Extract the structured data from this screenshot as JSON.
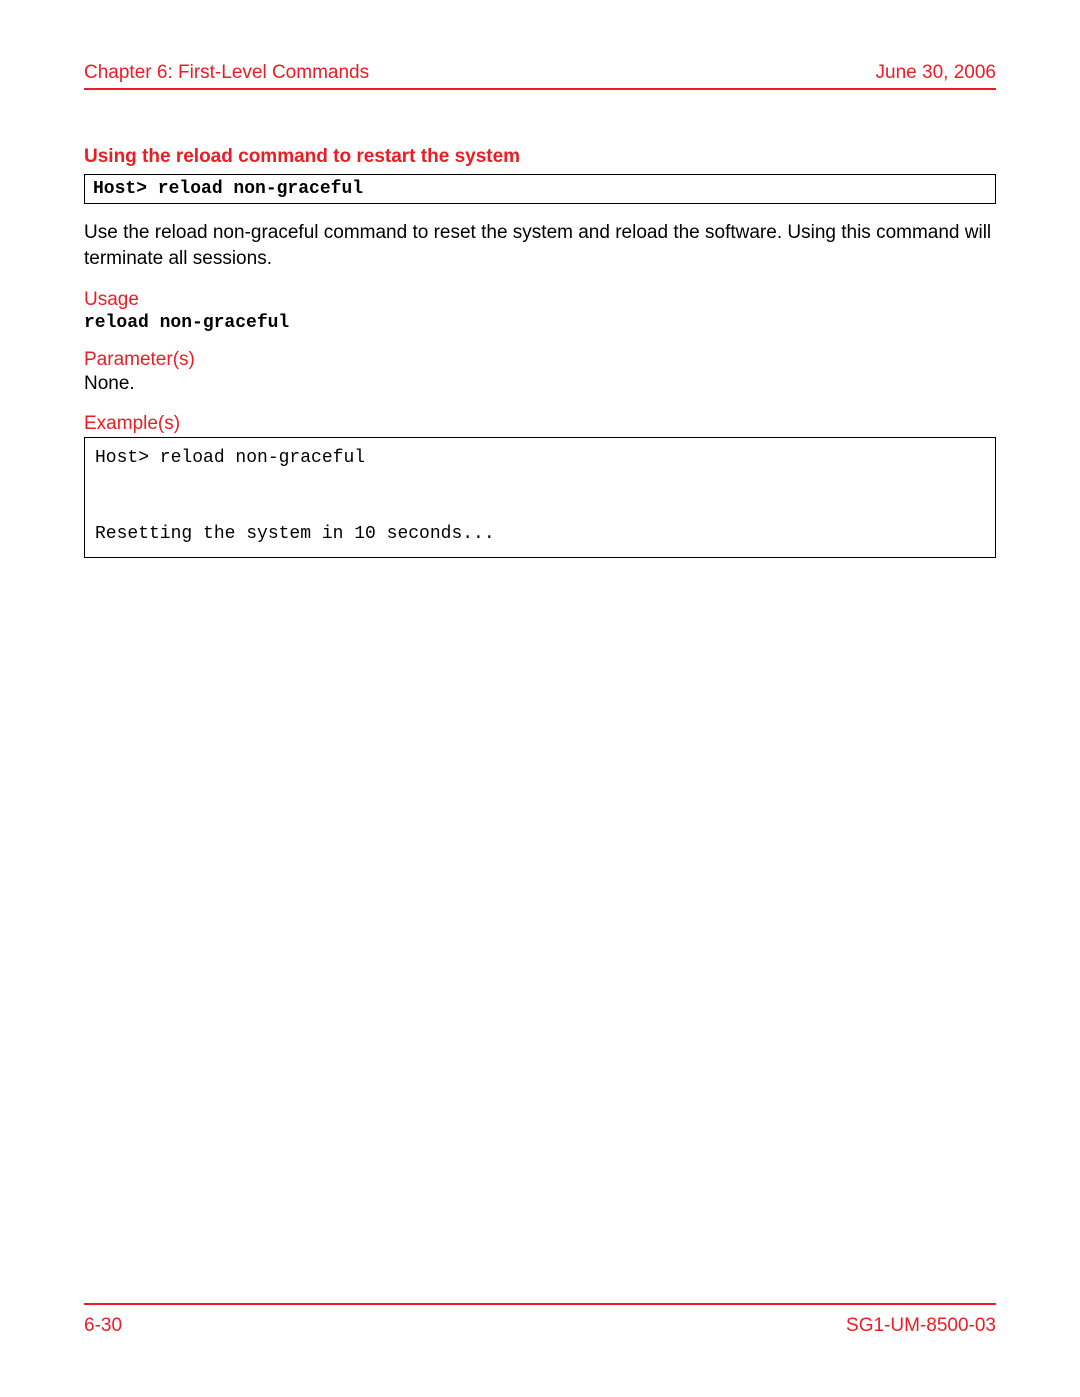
{
  "header": {
    "chapter": "Chapter 6: First-Level Commands",
    "date": "June 30, 2006"
  },
  "section": {
    "title": "Using the reload command to restart the system",
    "command_box": "Host> reload non-graceful",
    "description": "Use the reload non-graceful command to reset the system and reload the software. Using this command will terminate all sessions."
  },
  "usage": {
    "heading": "Usage",
    "code": "reload non-graceful"
  },
  "parameters": {
    "heading": "Parameter(s)",
    "value": "None."
  },
  "examples": {
    "heading": "Example(s)",
    "content": "Host> reload non-graceful\n\n\nResetting the system in 10 seconds..."
  },
  "footer": {
    "page": "6-30",
    "doc_id": "SG1-UM-8500-03"
  }
}
